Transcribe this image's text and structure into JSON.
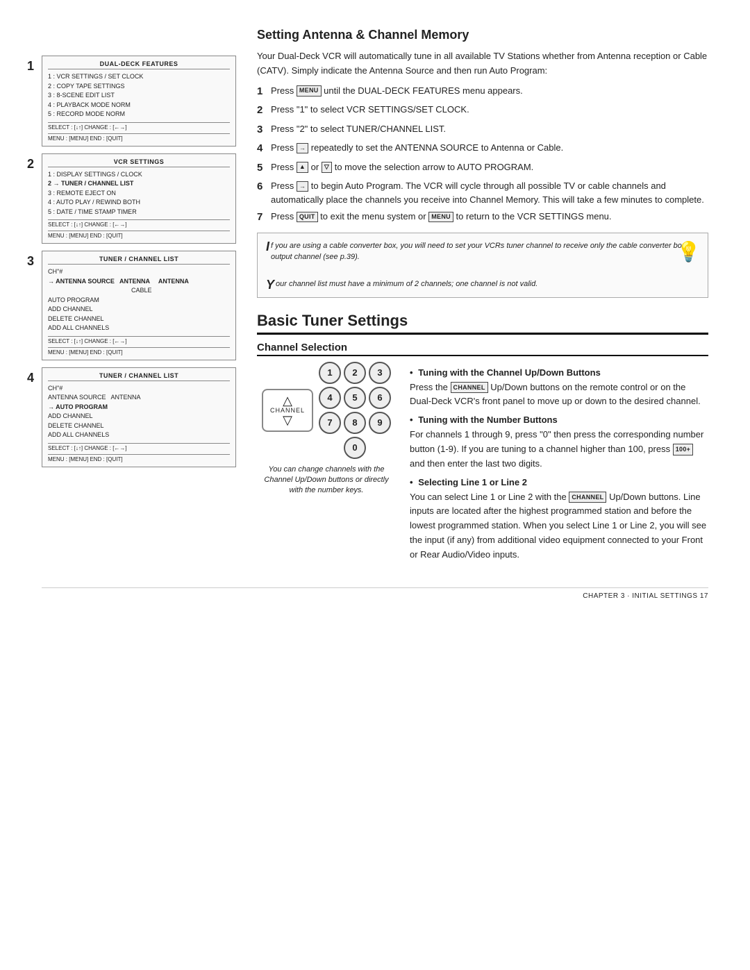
{
  "page": {
    "footer": "CHAPTER 3 · INITIAL SETTINGS   17"
  },
  "left_col": {
    "screens": [
      {
        "number": "1",
        "title": "DUAL-DECK FEATURES",
        "items": [
          "1 :  VCR SETTINGS / SET CLOCK",
          "2 :  COPY TAPE SETTINGS",
          "3 :  8-SCENE EDIT LIST",
          "4 :  PLAYBACK MODE      NORM",
          "5 :  RECORD MODE        NORM"
        ],
        "footer_left": "SELECT : [↓↑]   CHANGE : [←→]",
        "footer_right": "MENU : [MENU]   END : [QUIT]"
      },
      {
        "number": "2",
        "title": "VCR SETTINGS",
        "items": [
          "1 :  DISPLAY SETTINGS / CLOCK",
          "2 → TUNER / CHANNEL LIST",
          "3 :  REMOTE EJECT               ON",
          "4 :  AUTO PLAY / REWIND       BOTH",
          "5 :  DATE / TIME STAMP        TIMER"
        ],
        "footer_left": "SELECT : [↓↑]   CHANGE : [←→]",
        "footer_right": "MENU : [MENU]   END : [QUIT]"
      },
      {
        "number": "3",
        "title": "TUNER / CHANNEL LIST",
        "items": [
          "CH\"#",
          "→ ANTENNA SOURCE    ANTENNA    ANTENNA",
          "                               CABLE",
          "AUTO PROGRAM",
          "ADD CHANNEL",
          "DELETE CHANNEL",
          "ADD ALL CHANNELS"
        ],
        "footer_left": "SELECT : [↓↑]   CHANGE : [←→]",
        "footer_right": "MENU : [MENU]   END : [QUIT]"
      },
      {
        "number": "4",
        "title": "TUNER / CHANNEL LIST",
        "items": [
          "CH\"#",
          "ANTENNA SOURCE    ANTENNA",
          "→ AUTO PROGRAM",
          "ADD CHANNEL",
          "DELETE CHANNEL",
          "ADD ALL CHANNELS"
        ],
        "footer_left": "SELECT : [↓↑]   CHANGE : [←→]",
        "footer_right": "MENU : [MENU]   END : [QUIT]"
      }
    ]
  },
  "setting_antenna": {
    "section_title": "Setting Antenna & Channel Memory",
    "intro": "Your Dual-Deck VCR will automatically tune in all available TV Stations whether from Antenna reception or Cable (CATV). Simply indicate the Antenna Source and then run Auto Program:",
    "steps": [
      {
        "num": "1",
        "text": "Press [MENU] until the DUAL-DECK FEATURES menu appears."
      },
      {
        "num": "2",
        "text": "Press \"1\" to select VCR SETTINGS/SET CLOCK."
      },
      {
        "num": "3",
        "text": "Press \"2\" to select TUNER/CHANNEL LIST."
      },
      {
        "num": "4",
        "text": "Press [→] repeatedly to set the ANTENNA SOURCE to Antenna or Cable."
      },
      {
        "num": "5",
        "text": "Press [▲] or [▽] to move the selection arrow to AUTO PROGRAM."
      },
      {
        "num": "6",
        "text": "Press [→] to begin Auto Program. The VCR will cycle through all possible TV or cable channels and automatically place the channels you receive into Channel Memory. This will take a few minutes to complete."
      },
      {
        "num": "7",
        "text": "Press [QUIT] to exit the menu system or [MENU] to return to the VCR SETTINGS menu."
      }
    ],
    "tip1": "If you are using a cable converter box, you will need to set your VCRs tuner channel to receive only the cable converter box output channel (see p.39).",
    "tip2": "Your channel list must have a minimum of 2 channels; one channel is not valid."
  },
  "basic_tuner": {
    "section_title": "Basic Tuner Settings",
    "subsection_title": "Channel Selection",
    "bullet1_title": "Tuning with the Channel Up/Down Buttons",
    "bullet1_text": "Press the [CHANNEL] Up/Down buttons on the remote control or on the Dual-Deck VCR's front panel to move up or down to the desired channel.",
    "bullet2_title": "Tuning with the Number Buttons",
    "bullet2_text": "For channels 1 through 9, press \"0\" then press the corresponding number button (1-9). If you are tuning to a channel higher than 100, press [100+] and then enter the last two digits.",
    "bullet3_title": "Selecting Line 1 or Line 2",
    "bullet3_text": "You can select Line 1 or Line 2 with the [CHANNEL] Up/Down buttons. Line inputs are located after the highest programmed station and before the lowest programmed station. When you select Line 1 or Line 2, you will see the input (if any) from additional video equipment connected to your Front or Rear Audio/Video inputs.",
    "pad_caption": "You can change channels with the Channel Up/Down buttons or directly with the number keys.",
    "pad_label": "CHANNEL",
    "num_buttons": [
      "1",
      "2",
      "3",
      "4",
      "5",
      "6",
      "7",
      "8",
      "9",
      "0"
    ]
  }
}
